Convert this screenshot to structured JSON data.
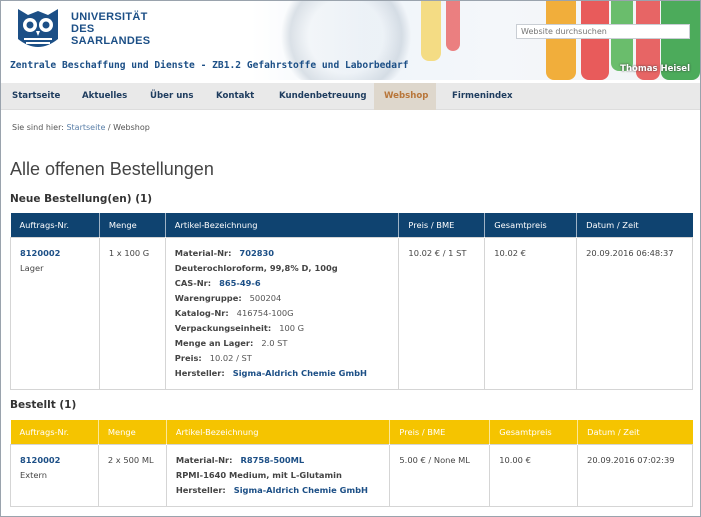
{
  "header": {
    "logo_text_lines": [
      "UNIVERSITÄT",
      "DES",
      "SAARLANDES"
    ],
    "search_placeholder": "Website durchsuchen",
    "site_title": "Zentrale Beschaffung und Dienste - ZB1.2 Gefahrstoffe und Laborbedarf",
    "user_name": "Thomas Heisel"
  },
  "nav": {
    "items": [
      "Startseite",
      "Aktuelles",
      "Über uns",
      "Kontakt",
      "Kundenbetreuung",
      "Webshop",
      "Firmenindex"
    ],
    "active": "Webshop"
  },
  "breadcrumb": {
    "prefix": "Sie sind hier:",
    "home": "Startseite",
    "separator": "/",
    "current": "Webshop"
  },
  "page_title": "Alle offenen Bestellungen",
  "columns": [
    "Auftrags-Nr.",
    "Menge",
    "Artikel-Bezeichnung",
    "Preis / BME",
    "Gesamtpreis",
    "Datum / Zeit"
  ],
  "new_orders": {
    "title": "Neue Bestellung(en) (1)",
    "header_color": "#0f4370",
    "rows": [
      {
        "order_no": "8120002",
        "location": "Lager",
        "quantity": "1 x 100 G",
        "material_label": "Material-Nr:",
        "material_no": "702830",
        "description": "Deuterochloroform, 99,8% D, 100g",
        "cas_label": "CAS-Nr:",
        "cas_no": "865-49-6",
        "group_label": "Warengruppe:",
        "group": "500204",
        "catalog_label": "Katalog-Nr:",
        "catalog": "416754-100G",
        "unit_label": "Verpackungseinheit:",
        "unit": "100 G",
        "stock_label": "Menge an Lager:",
        "stock": "2.0 ST",
        "price_label": "Preis:",
        "price_detail": "10.02 / ST",
        "manufacturer_label": "Hersteller:",
        "manufacturer": "Sigma-Aldrich Chemie GmbH",
        "price_bme": "10.02 € / 1 ST",
        "total": "10.02 €",
        "datetime": "20.09.2016 06:48:37"
      }
    ]
  },
  "ordered": {
    "title": "Bestellt (1)",
    "header_color": "#f5c400",
    "rows": [
      {
        "order_no": "8120002",
        "location": "Extern",
        "quantity": "2 x 500 ML",
        "material_label": "Material-Nr:",
        "material_no": "R8758-500ML",
        "description": "RPMI-1640 Medium, mit L-Glutamin",
        "manufacturer_label": "Hersteller:",
        "manufacturer": "Sigma-Aldrich Chemie GmbH",
        "price_bme": "5.00 € / None ML",
        "total": "10.00 €",
        "datetime": "20.09.2016 07:02:39"
      }
    ]
  }
}
